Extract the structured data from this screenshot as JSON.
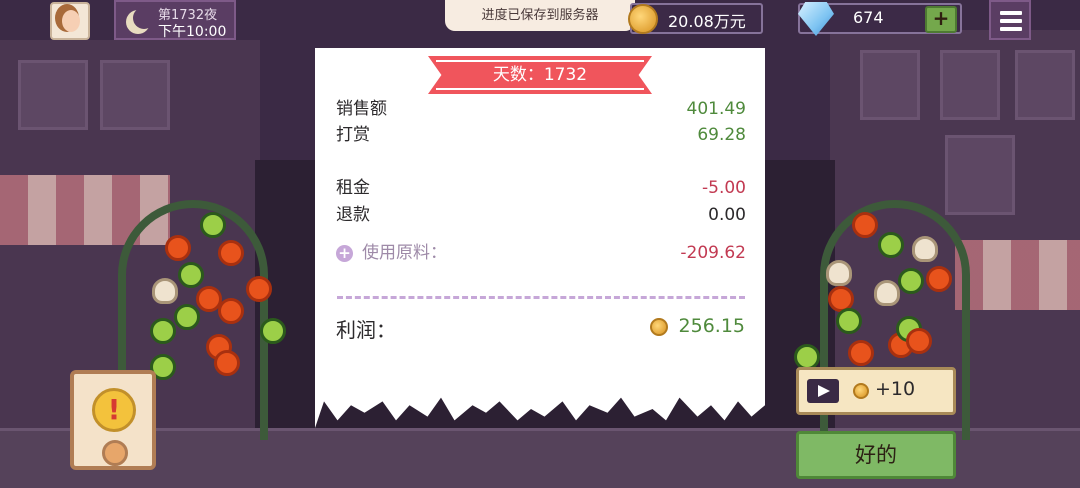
{
  "hud": {
    "day_label": "第1732夜",
    "time_label": "下午10:00",
    "toast": "进度已保存到服务器",
    "money": "20.08万元",
    "gems": "674",
    "add_gems": "+"
  },
  "receipt": {
    "banner": "天数：1732",
    "rows": [
      {
        "label": "销售额",
        "value": "401.49"
      },
      {
        "label": "打赏",
        "value": "69.28"
      },
      {
        "label": "租金",
        "value": "-5.00"
      },
      {
        "label": "退款",
        "value": "0.00"
      },
      {
        "label": "使用原料：",
        "value": "-209.62"
      }
    ],
    "expand_icon": "+",
    "profit_label": "利润：",
    "profit_value": "256.15"
  },
  "buttons": {
    "ad_reward": "+10",
    "ok": "好的",
    "alert": "!"
  },
  "colors": {
    "positive": "#4f8a3c",
    "negative": "#c23a52",
    "banner": "#f0555c",
    "ok_button": "#7fb965"
  }
}
